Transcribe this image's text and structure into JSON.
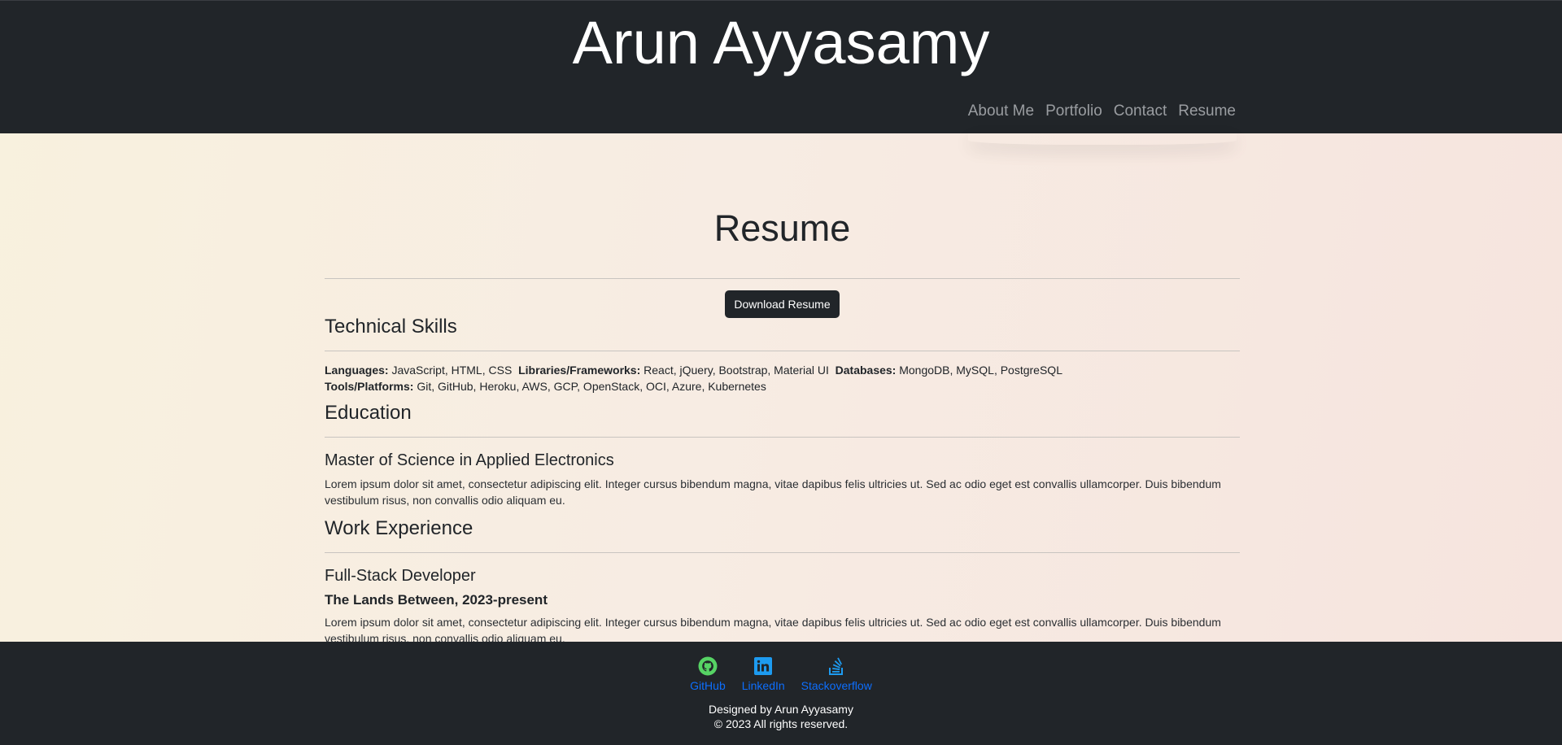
{
  "header": {
    "site_title": "Arun Ayyasamy",
    "nav": [
      "About Me",
      "Portfolio",
      "Contact",
      "Resume"
    ]
  },
  "main": {
    "heading": "Resume",
    "download_button": "Download Resume",
    "technical_skills": {
      "title": "Technical Skills",
      "languages_label": "Languages:",
      "languages": "JavaScript, HTML, CSS",
      "libraries_label": "Libraries/Frameworks:",
      "libraries": "React, jQuery, Bootstrap, Material UI",
      "databases_label": "Databases:",
      "databases": "MongoDB, MySQL, PostgreSQL",
      "tools_label": "Tools/Platforms:",
      "tools": "Git, GitHub, Heroku, AWS, GCP, OpenStack, OCI, Azure, Kubernetes"
    },
    "education": {
      "title": "Education",
      "degree": "Master of Science in Applied Electronics",
      "description": "Lorem ipsum dolor sit amet, consectetur adipiscing elit. Integer cursus bibendum magna, vitae dapibus felis ultricies ut. Sed ac odio eget est convallis ullamcorper. Duis bibendum vestibulum risus, non convallis odio aliquam eu."
    },
    "work_experience": {
      "title": "Work Experience",
      "role": "Full-Stack Developer",
      "company_period": "The Lands Between, 2023-present",
      "description": "Lorem ipsum dolor sit amet, consectetur adipiscing elit. Integer cursus bibendum magna, vitae dapibus felis ultricies ut. Sed ac odio eget est convallis ullamcorper. Duis bibendum vestibulum risus, non convallis odio aliquam eu."
    }
  },
  "footer": {
    "links": [
      {
        "label": "GitHub",
        "icon": "github-icon",
        "color": "#56d364"
      },
      {
        "label": "LinkedIn",
        "icon": "linkedin-icon",
        "color": "#1d9bf0"
      },
      {
        "label": "Stackoverflow",
        "icon": "stackoverflow-icon",
        "color": "#1d9bf0"
      }
    ],
    "credit_line1": "Designed by Arun Ayyasamy",
    "credit_line2": "© 2023 All rights reserved."
  },
  "colors": {
    "header_bg": "#212529",
    "link": "#0d6efd",
    "nav_text": "#9a9da1"
  }
}
